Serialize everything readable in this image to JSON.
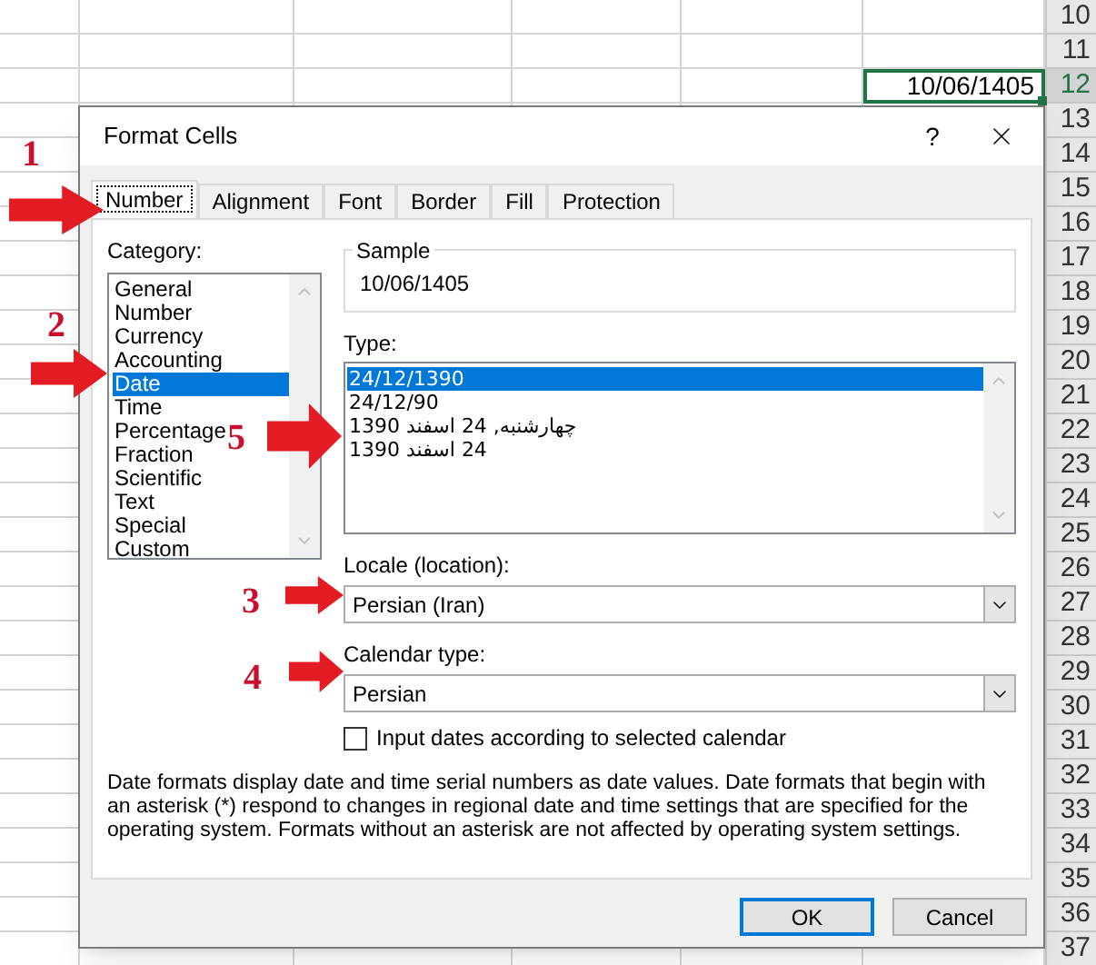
{
  "sheet": {
    "row_headers": [
      {
        "label": "10",
        "selected": false
      },
      {
        "label": "11",
        "selected": false
      },
      {
        "label": "12",
        "selected": true
      },
      {
        "label": "13",
        "selected": false
      },
      {
        "label": "14",
        "selected": false
      },
      {
        "label": "15",
        "selected": false
      },
      {
        "label": "16",
        "selected": false
      },
      {
        "label": "17",
        "selected": false
      },
      {
        "label": "18",
        "selected": false
      },
      {
        "label": "19",
        "selected": false
      },
      {
        "label": "20",
        "selected": false
      },
      {
        "label": "21",
        "selected": false
      },
      {
        "label": "22",
        "selected": false
      },
      {
        "label": "23",
        "selected": false
      },
      {
        "label": "24",
        "selected": false
      },
      {
        "label": "25",
        "selected": false
      },
      {
        "label": "26",
        "selected": false
      },
      {
        "label": "27",
        "selected": false
      },
      {
        "label": "28",
        "selected": false
      },
      {
        "label": "29",
        "selected": false
      },
      {
        "label": "30",
        "selected": false
      },
      {
        "label": "31",
        "selected": false
      },
      {
        "label": "32",
        "selected": false
      },
      {
        "label": "33",
        "selected": false
      },
      {
        "label": "34",
        "selected": false
      },
      {
        "label": "35",
        "selected": false
      },
      {
        "label": "36",
        "selected": false
      },
      {
        "label": "37",
        "selected": false
      }
    ],
    "active_cell": "10/06/1405"
  },
  "dialog": {
    "title": "Format Cells",
    "help": "?",
    "tabs": [
      {
        "label": "Number",
        "selected": true
      },
      {
        "label": "Alignment",
        "selected": false
      },
      {
        "label": "Font",
        "selected": false
      },
      {
        "label": "Border",
        "selected": false
      },
      {
        "label": "Fill",
        "selected": false
      },
      {
        "label": "Protection",
        "selected": false
      }
    ],
    "category": {
      "label": "Category:",
      "items": [
        {
          "label": "General",
          "selected": false
        },
        {
          "label": "Number",
          "selected": false
        },
        {
          "label": "Currency",
          "selected": false
        },
        {
          "label": "Accounting",
          "selected": false
        },
        {
          "label": "Date",
          "selected": true
        },
        {
          "label": "Time",
          "selected": false
        },
        {
          "label": "Percentage",
          "selected": false
        },
        {
          "label": "Fraction",
          "selected": false
        },
        {
          "label": "Scientific",
          "selected": false
        },
        {
          "label": "Text",
          "selected": false
        },
        {
          "label": "Special",
          "selected": false
        },
        {
          "label": "Custom",
          "selected": false
        }
      ]
    },
    "sample": {
      "label": "Sample",
      "value": "10/06/1405"
    },
    "type": {
      "label": "Type:",
      "items": [
        {
          "label": "24/12/1390",
          "selected": true
        },
        {
          "label": "24/12/90",
          "selected": false
        },
        {
          "label": "چهارشنبه, 24 اسفند 1390",
          "selected": false
        },
        {
          "label": "24 اسفند 1390",
          "selected": false
        }
      ]
    },
    "locale": {
      "label": "Locale (location):",
      "value": "Persian (Iran)"
    },
    "calendar": {
      "label": "Calendar type:",
      "value": "Persian"
    },
    "input_dates": {
      "label": "Input dates according to selected calendar",
      "checked": false
    },
    "description": "Date formats display date and time serial numbers as date values.  Date formats that begin with an asterisk (*) respond to changes in regional date and time settings that are specified for the operating system. Formats without an asterisk are not affected by operating system settings.",
    "buttons": [
      {
        "label": "OK",
        "default": true
      },
      {
        "label": "Cancel",
        "default": false
      }
    ]
  },
  "annotations": [
    {
      "number": "1"
    },
    {
      "number": "2"
    },
    {
      "number": "3"
    },
    {
      "number": "4"
    },
    {
      "number": "5"
    }
  ]
}
